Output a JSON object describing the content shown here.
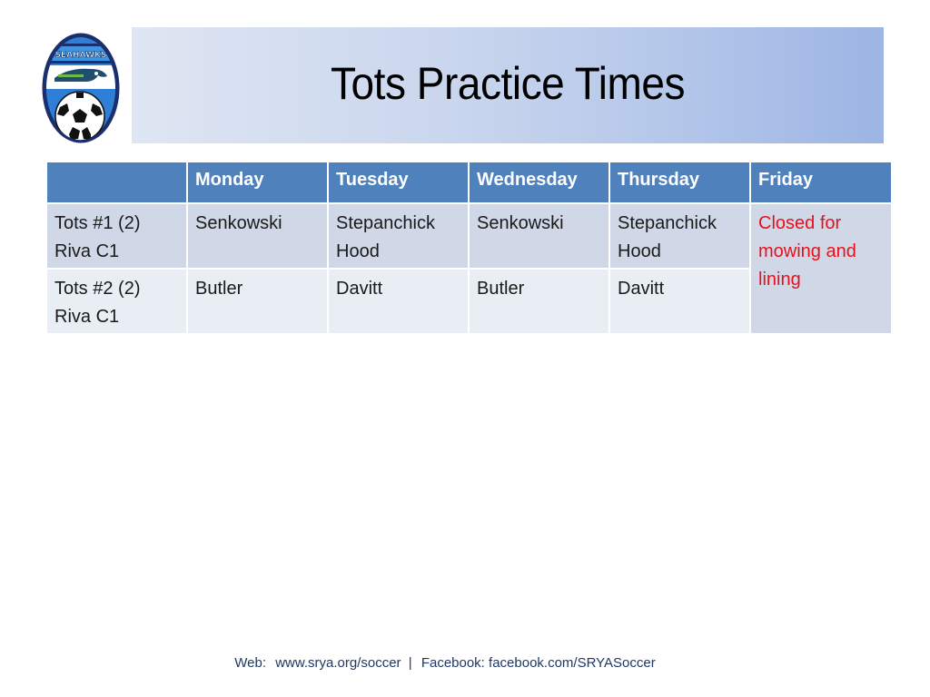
{
  "logo": {
    "icon": "seahawks-soccer-crest-icon",
    "text": "SEAHAWKS"
  },
  "title": "Tots Practice Times",
  "table": {
    "headers": [
      "",
      "Monday",
      "Tuesday",
      "Wednesday",
      "Thursday",
      "Friday"
    ],
    "rows": [
      {
        "team_line1": "Tots #1 (2)",
        "team_line2": "Riva C1",
        "monday": "Senkowski",
        "tuesday_line1": "Stepanchick",
        "tuesday_line2": "Hood",
        "wednesday": "Senkowski",
        "thursday_line1": "Stepanchick",
        "thursday_line2": "Hood"
      },
      {
        "team_line1": "Tots #2 (2)",
        "team_line2": "Riva C1",
        "monday": "Butler",
        "tuesday_line1": "Davitt",
        "tuesday_line2": "",
        "wednesday": "Butler",
        "thursday_line1": "Davitt",
        "thursday_line2": ""
      }
    ],
    "friday_note_line1": "Closed for",
    "friday_note_line2": "mowing and",
    "friday_note_line3": "lining",
    "friday_note_color": "#e8101a",
    "header_color": "#4f81bd"
  },
  "footer": {
    "web_label": "Web:",
    "web_url": "www.srya.org/soccer",
    "separator": "|",
    "facebook_label": "Facebook:",
    "facebook_url": "facebook.com/SRYASoccer"
  }
}
